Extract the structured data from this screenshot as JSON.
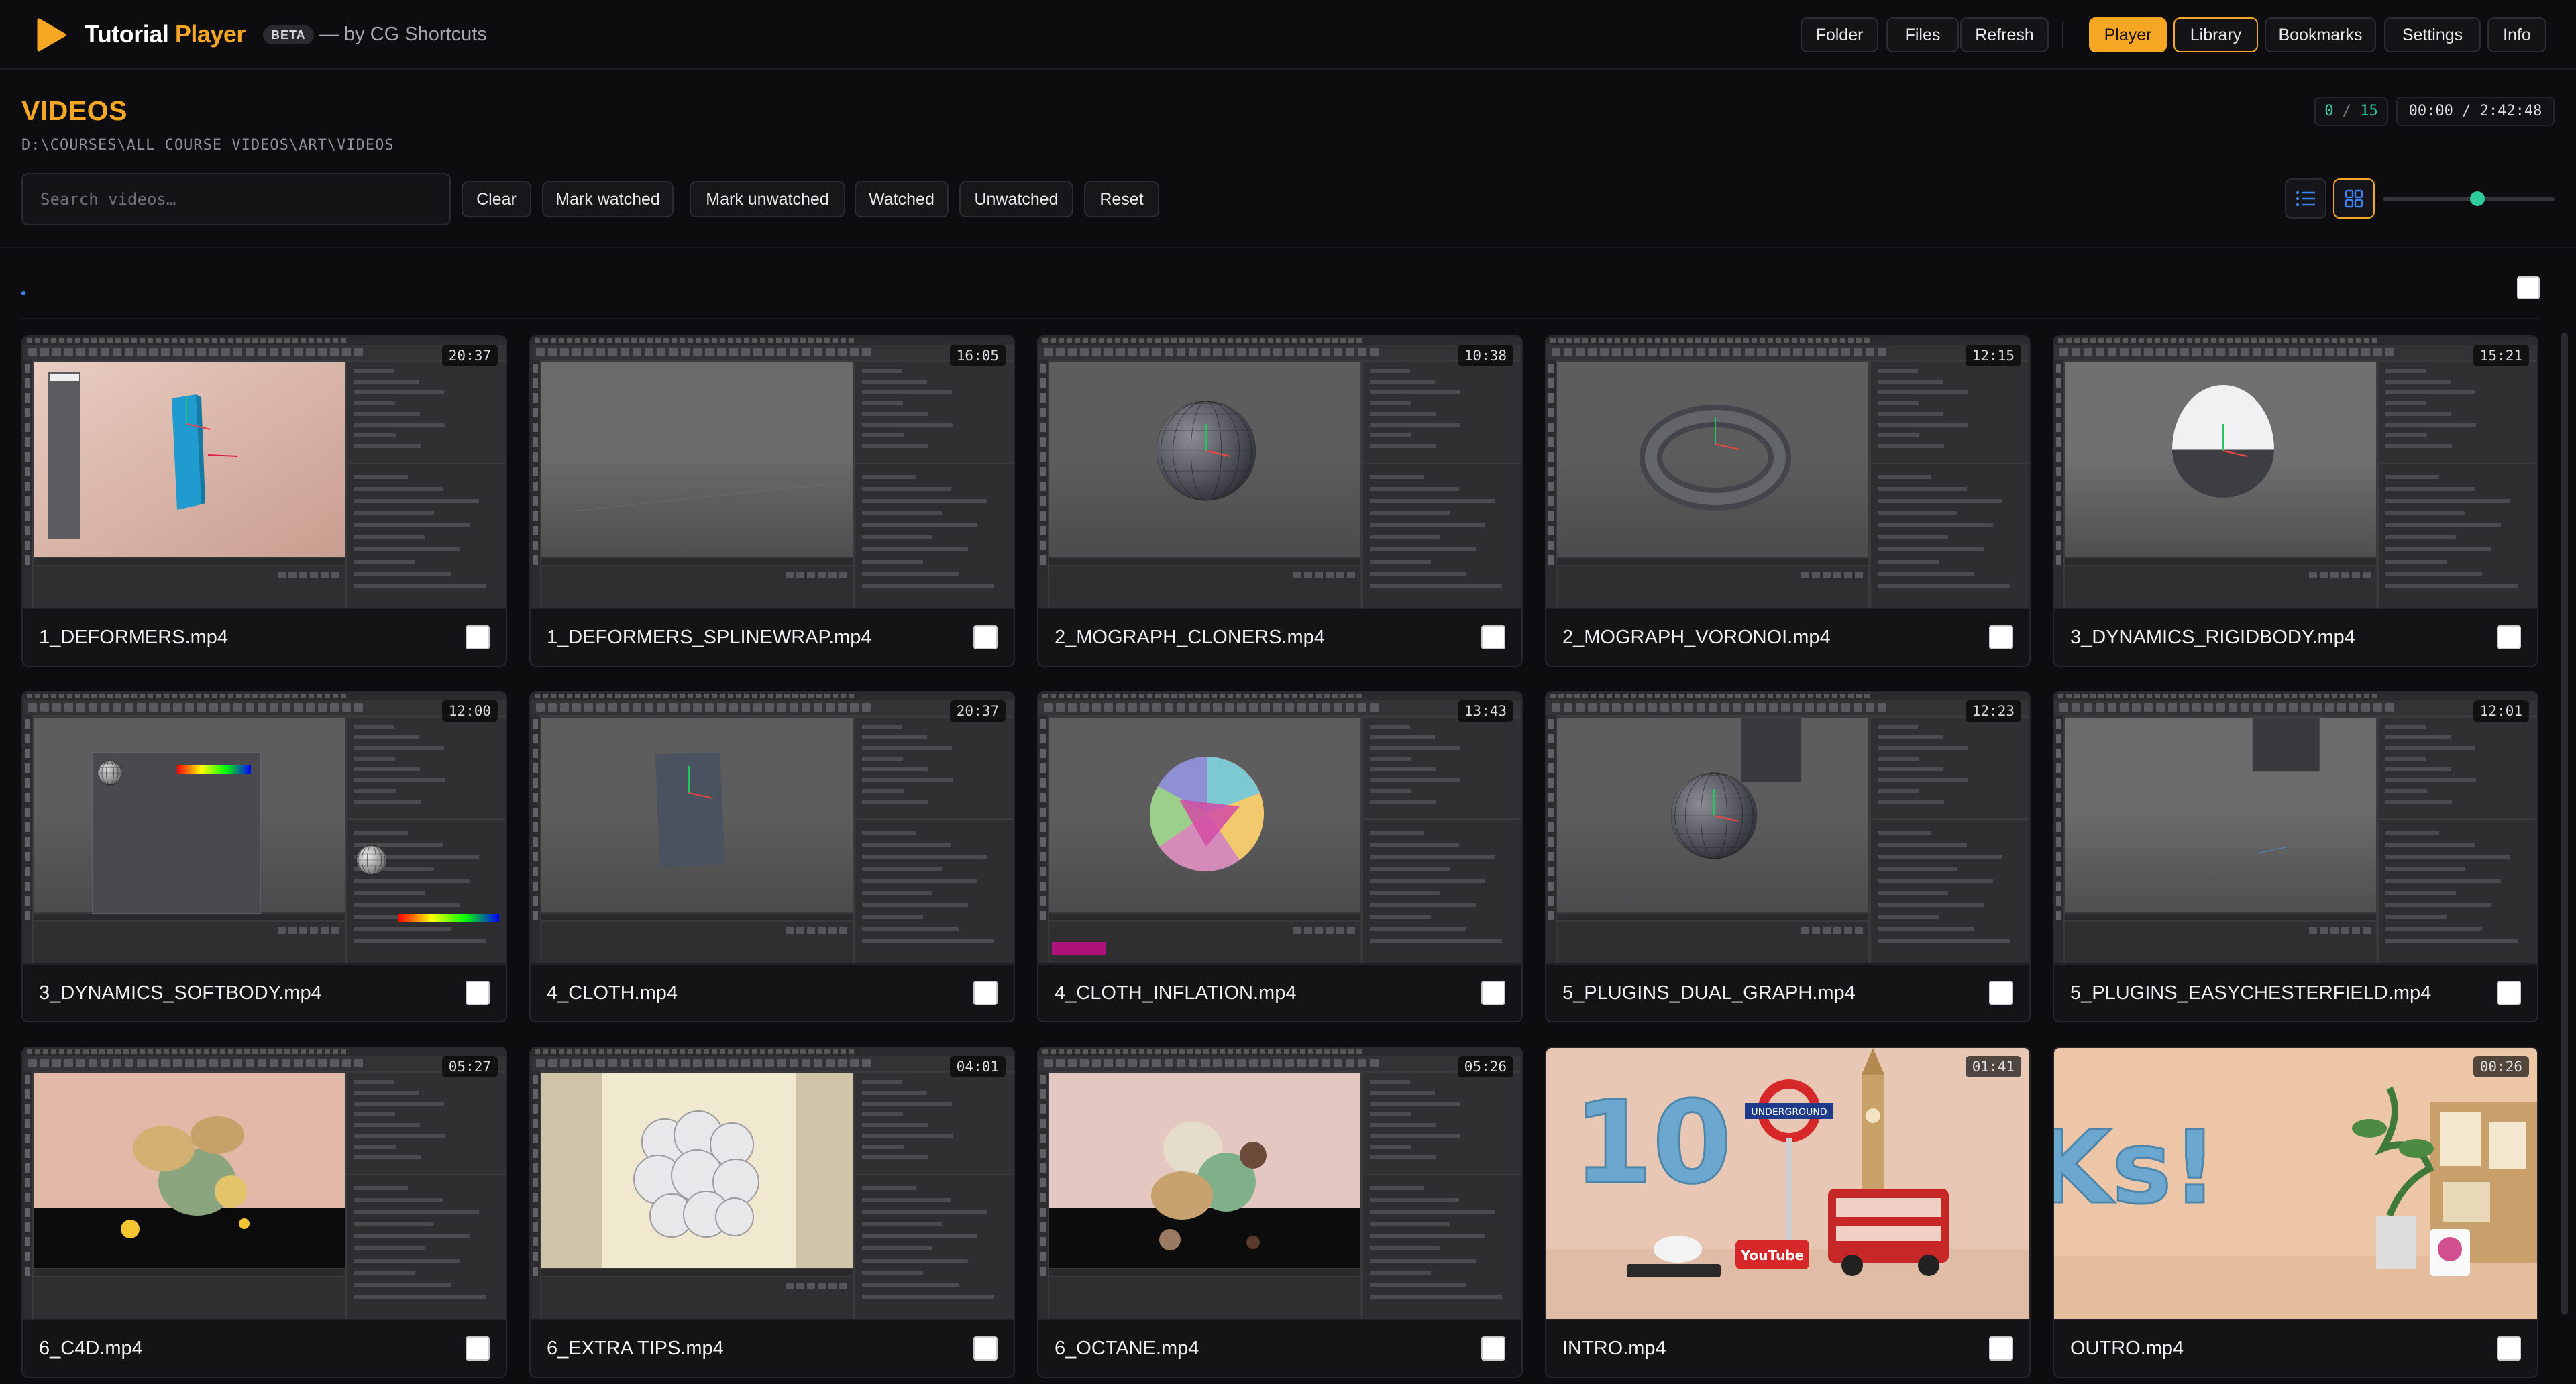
{
  "app": {
    "name_part1": "Tutorial",
    "name_part2": "Player",
    "badge": "BETA",
    "byline": "— by CG Shortcuts"
  },
  "nav": {
    "folder": "Folder",
    "files": "Files",
    "refresh": "Refresh",
    "player": "Player",
    "library": "Library",
    "bookmarks": "Bookmarks",
    "settings": "Settings",
    "info": "Info"
  },
  "header": {
    "title": "VIDEOS",
    "path": "D:\\COURSES\\ALL COURSE VIDEOS\\ART\\VIDEOS",
    "watched_count": "0",
    "count_sep": " / ",
    "total_count": "15",
    "time": "00:00 / 2:42:48"
  },
  "toolbar": {
    "search_placeholder": "Search videos…",
    "search_value": "",
    "clear": "Clear",
    "mark_watched": "Mark watched",
    "mark_unwatched": "Mark unwatched",
    "watched": "Watched",
    "unwatched": "Unwatched",
    "reset": "Reset",
    "view_mode": "grid",
    "thumb_size_fraction": 0.55
  },
  "group": {
    "label": "."
  },
  "colors": {
    "accent": "#f5a623",
    "success": "#2ecc9a",
    "background": "#0d0d0f"
  },
  "videos": [
    {
      "name": "1_DEFORMERS.mp4",
      "duration": "20:37",
      "thumb": "c4d-deformers"
    },
    {
      "name": "1_DEFORMERS_SPLINEWRAP.mp4",
      "duration": "16:05",
      "thumb": "c4d-empty"
    },
    {
      "name": "2_MOGRAPH_CLONERS.mp4",
      "duration": "10:38",
      "thumb": "c4d-sphere"
    },
    {
      "name": "2_MOGRAPH_VORONOI.mp4",
      "duration": "12:15",
      "thumb": "c4d-torus"
    },
    {
      "name": "3_DYNAMICS_RIGIDBODY.mp4",
      "duration": "15:21",
      "thumb": "c4d-capsule"
    },
    {
      "name": "3_DYNAMICS_SOFTBODY.mp4",
      "duration": "12:00",
      "thumb": "c4d-material"
    },
    {
      "name": "4_CLOTH.mp4",
      "duration": "20:37",
      "thumb": "c4d-cloth"
    },
    {
      "name": "4_CLOTH_INFLATION.mp4",
      "duration": "13:43",
      "thumb": "c4d-colorball"
    },
    {
      "name": "5_PLUGINS_DUAL_GRAPH.mp4",
      "duration": "12:23",
      "thumb": "c4d-sphere-small"
    },
    {
      "name": "5_PLUGINS_EASYCHESTERFIELD.mp4",
      "duration": "12:01",
      "thumb": "c4d-empty-menu"
    },
    {
      "name": "6_C4D.mp4",
      "duration": "05:27",
      "thumb": "render-pink"
    },
    {
      "name": "6_EXTRA TIPS.mp4",
      "duration": "04:01",
      "thumb": "render-cube"
    },
    {
      "name": "6_OCTANE.mp4",
      "duration": "05:26",
      "thumb": "render-octane"
    },
    {
      "name": "INTRO.mp4",
      "duration": "01:41",
      "thumb": "intro-london"
    },
    {
      "name": "OUTRO.mp4",
      "duration": "00:26",
      "thumb": "outro-desk"
    }
  ]
}
